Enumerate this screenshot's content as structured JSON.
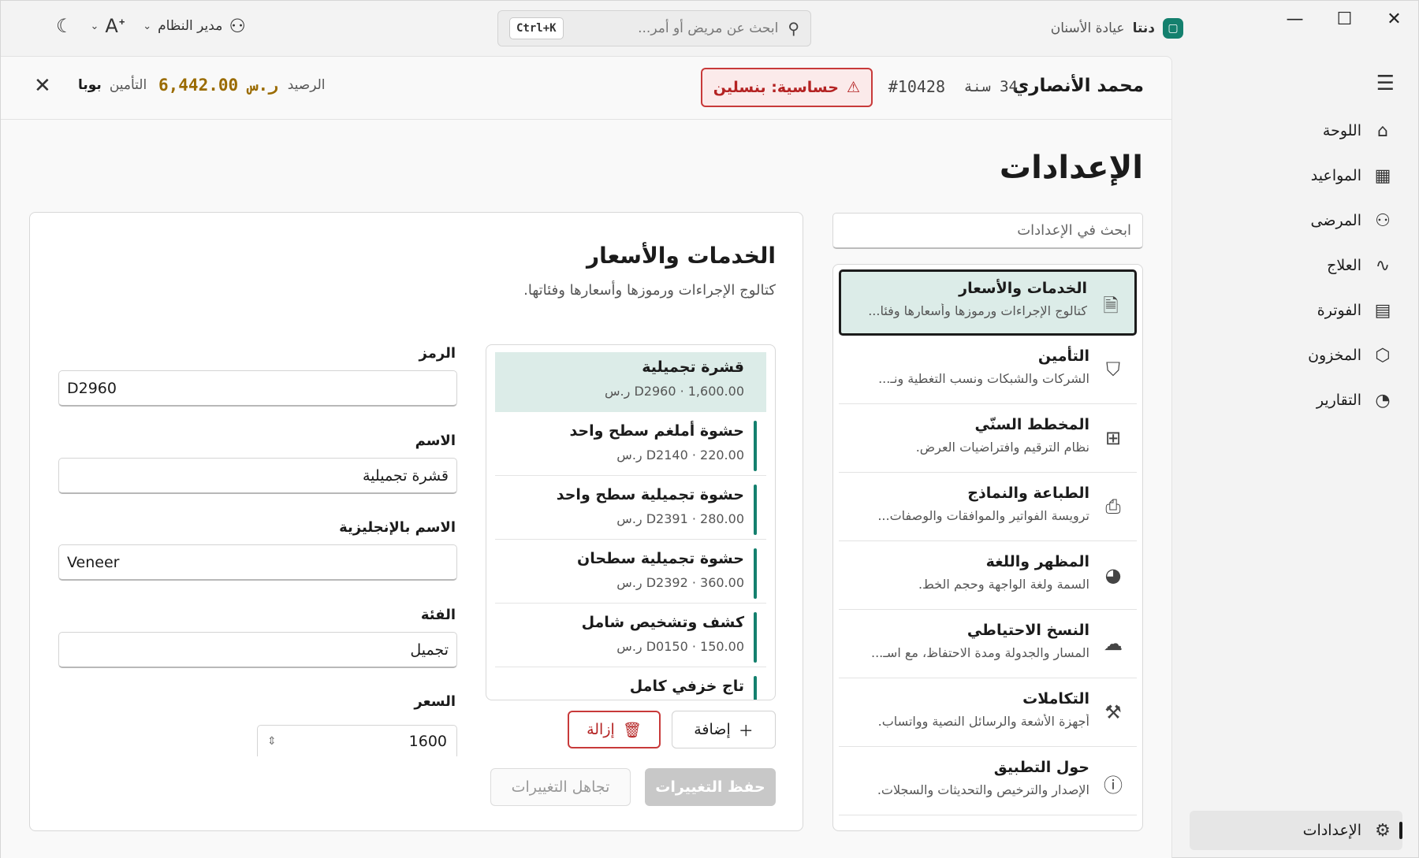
{
  "app": {
    "name": "دنتا",
    "subtitle": "عيادة الأسنان",
    "logo_icon": "tooth-icon"
  },
  "titlebar": {
    "search_placeholder": "ابحث عن مريض أو أمر...",
    "shortcut": "Ctrl+K",
    "user_label": "مدير النظام"
  },
  "nav": {
    "items": [
      {
        "label": "اللوحة",
        "icon": "home-icon"
      },
      {
        "label": "المواعيد",
        "icon": "calendar-icon"
      },
      {
        "label": "المرضى",
        "icon": "users-icon"
      },
      {
        "label": "العلاج",
        "icon": "stethoscope-icon"
      },
      {
        "label": "الفوترة",
        "icon": "invoice-icon"
      },
      {
        "label": "المخزون",
        "icon": "box-icon"
      },
      {
        "label": "التقارير",
        "icon": "chart-icon"
      }
    ],
    "settings_label": "الإعدادات"
  },
  "patient": {
    "name": "محمد الأنصاري",
    "age": "34 سنة",
    "id": "#10428",
    "allergy": "حساسية: بنسلين",
    "balance_label": "الرصيد",
    "balance_amount": "6,442.00 ر.س",
    "insurance_label": "التأمين",
    "insurance_value": "بوبا"
  },
  "page": {
    "title": "الإعدادات",
    "search_placeholder": "ابحث في الإعدادات"
  },
  "settings": [
    {
      "title": "الخدمات والأسعار",
      "desc": "كتالوج الإجراءات ورموزها وأسعارها وفئا...",
      "icon": "document-icon",
      "active": true
    },
    {
      "title": "التأمين",
      "desc": "الشركات والشبكات ونسب التغطية ونـ...",
      "icon": "shield-icon"
    },
    {
      "title": "المخطط السنّي",
      "desc": "نظام الترقيم وافتراضيات العرض.",
      "icon": "grid-icon"
    },
    {
      "title": "الطباعة والنماذج",
      "desc": "ترويسة الفواتير والموافقات والوصفات...",
      "icon": "printer-icon"
    },
    {
      "title": "المظهر واللغة",
      "desc": "السمة ولغة الواجهة وحجم الخط.",
      "icon": "palette-icon"
    },
    {
      "title": "النسخ الاحتياطي",
      "desc": "المسار والجدولة ومدة الاحتفاظ، مع اسـ...",
      "icon": "cloud-upload-icon"
    },
    {
      "title": "التكاملات",
      "desc": "أجهزة الأشعة والرسائل النصية وواتساب.",
      "icon": "wrench-icon"
    },
    {
      "title": "حول التطبيق",
      "desc": "الإصدار والترخيص والتحديثات والسجلات.",
      "icon": "info-icon"
    }
  ],
  "panel": {
    "title": "الخدمات والأسعار",
    "subtitle": "كتالوج الإجراءات ورموزها وأسعارها وفئاتها.",
    "services": [
      {
        "name": "قشرة تجميلية",
        "meta": "D2960 · 1,600.00 ر.س",
        "active": true
      },
      {
        "name": "حشوة أملغم سطح واحد",
        "meta": "D2140 · 220.00 ر.س"
      },
      {
        "name": "حشوة تجميلية سطح واحد",
        "meta": "D2391 · 280.00 ر.س"
      },
      {
        "name": "حشوة تجميلية سطحان",
        "meta": "D2392 · 360.00 ر.س"
      },
      {
        "name": "كشف وتشخيص شامل",
        "meta": "D0150 · 150.00 ر.س"
      },
      {
        "name": "تاج خزفي كامل",
        "meta": ""
      }
    ],
    "add_label": "إضافة",
    "remove_label": "إزالة",
    "save_label": "حفظ التغييرات",
    "discard_label": "تجاهل التغييرات",
    "form": {
      "code_label": "الرمز",
      "code_value": "D2960",
      "name_label": "الاسم",
      "name_value": "قشرة تجميلية",
      "name_en_label": "الاسم بالإنجليزية",
      "name_en_value": "Veneer",
      "category_label": "الفئة",
      "category_value": "تجميل",
      "price_label": "السعر",
      "price_value": "1600"
    }
  },
  "colors": {
    "accent": "#14806e",
    "danger": "#c83a3a",
    "balance": "#9a6b00",
    "selected_bg": "#dcece8"
  }
}
